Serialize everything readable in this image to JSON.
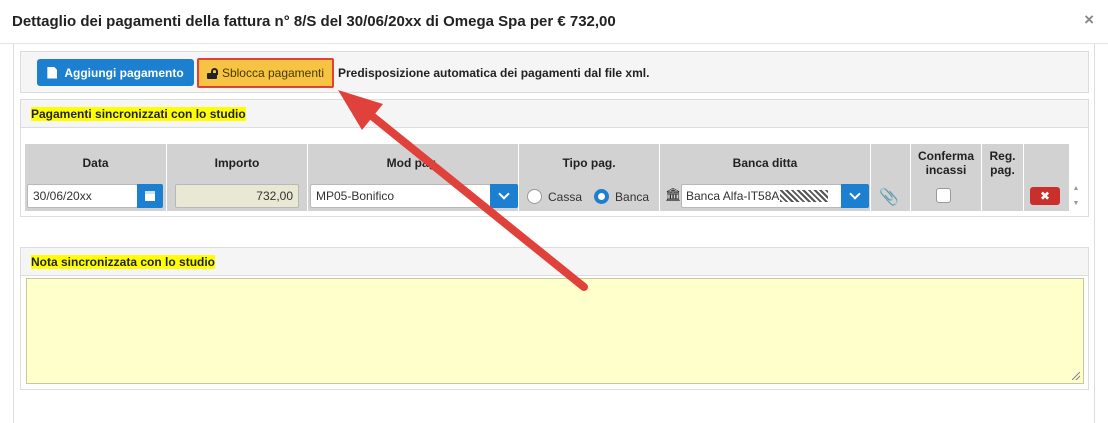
{
  "dialog": {
    "title": "Dettaglio dei pagamenti della fattura n° 8/S del 30/06/20xx di Omega Spa per € 732,00",
    "close_label": "×"
  },
  "toolbar": {
    "add_label": "Aggiungi pagamento",
    "unlock_label": "Sblocca pagamenti",
    "hint": "Predisposizione automatica dei pagamenti dal file xml."
  },
  "payments": {
    "heading": "Pagamenti sincronizzati con lo studio",
    "columns": {
      "data": "Data",
      "importo": "Importo",
      "mod_pag": "Mod pag.",
      "tipo_pag": "Tipo pag.",
      "banca": "Banca ditta",
      "conferma_line1": "Conferma",
      "conferma_line2": "incassi",
      "reg_line1": "Reg.",
      "reg_line2": "pag."
    },
    "row": {
      "date": "30/06/20xx",
      "amount": "732,00",
      "mod_pag": "MP05-Bonifico",
      "tipo_option_1": "Cassa",
      "tipo_option_2": "Banca",
      "tipo_selected": "Banca",
      "bank": "Banca Alfa-IT58A",
      "delete_label": "✖"
    }
  },
  "note": {
    "heading": "Nota sincronizzata con lo studio",
    "value": ""
  },
  "colors": {
    "primary": "#1c7fcf",
    "highlight": "#ffff00",
    "warning": "#f6c342",
    "danger": "#c9302c",
    "annotation_arrow": "#e0413a"
  },
  "icons": {
    "add": "document-icon",
    "unlock": "unlock-icon",
    "date": "calendar-icon",
    "bank": "bank-icon",
    "attach": "paperclip-icon",
    "delete": "close-icon"
  }
}
